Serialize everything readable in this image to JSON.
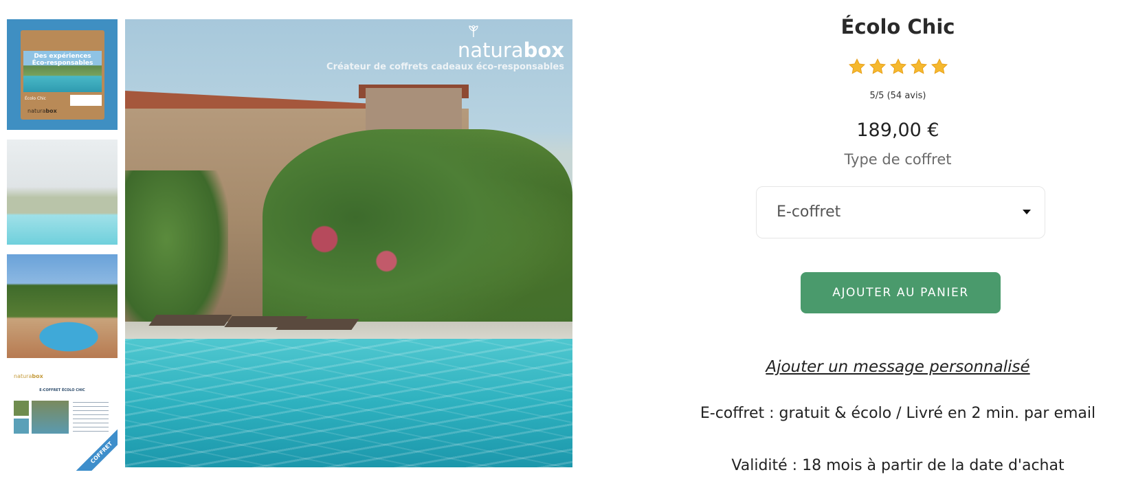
{
  "brand": {
    "name_light": "natura",
    "name_bold": "box",
    "tagline": "Créateur de coffrets cadeaux éco-responsables"
  },
  "thumbnails": {
    "t1": {
      "title_line1": "Des expériences",
      "title_line2": "Éco-responsables",
      "label": "Écolo Chic",
      "logo_light": "natura",
      "logo_bold": "box"
    },
    "t4": {
      "logo_light": "natura",
      "logo_bold": "box",
      "heading": "E-COFFRET ÉCOLO CHIC",
      "ribbon": "COFFRET"
    }
  },
  "product": {
    "title": "Écolo Chic",
    "stars": 5,
    "rating_text": "5/5 (54 avis)",
    "price": "189,00 €",
    "type_label": "Type de coffret",
    "selected_type": "E-coffret",
    "add_to_cart": "AJOUTER AU PANIER",
    "message_link": "Ajouter un message personnalisé",
    "info_line1": "E-coffret : gratuit & écolo / Livré en 2 min. par email",
    "info_line2": "Validité : 18 mois à partir de la date d'achat"
  },
  "colors": {
    "accent_green": "#4a9a6c",
    "star": "#f5b82e"
  }
}
